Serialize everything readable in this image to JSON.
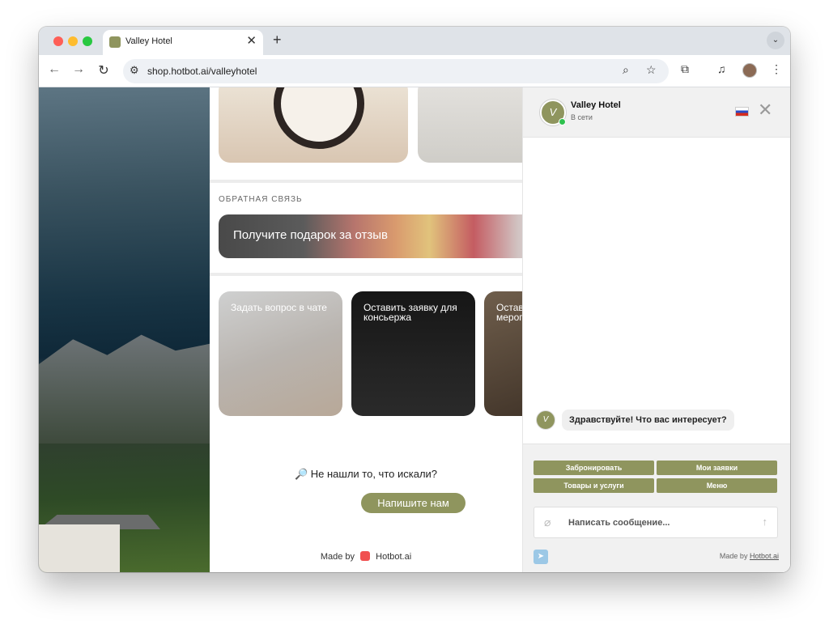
{
  "colors": {
    "accent": "#8f955e",
    "online": "#2ec14e",
    "traffic_red": "#fe5f57",
    "traffic_yellow": "#febc2e",
    "traffic_green": "#28c840"
  },
  "browser": {
    "tab_title": "Valley Hotel",
    "tab_close": "✕",
    "new_tab": "+",
    "tab_menu": "⌄",
    "url": "shop.hotbot.ai/valleyhotel"
  },
  "page": {
    "feedback_section_title": "ОБРАТНАЯ СВЯЗЬ",
    "feedback_banner": "Получите подарок за отзыв",
    "services": [
      {
        "label": "Задать вопрос в чате"
      },
      {
        "label": "Оставить заявку для консьержа"
      },
      {
        "label": "Оставить заявку на мероприятие"
      }
    ],
    "not_found_icon": "🔎",
    "not_found_text": "Не нашли то, что искали?",
    "write_us_button": "Напишите нам",
    "made_by": "Made by",
    "made_by_brand": "Hotbot.ai"
  },
  "chat": {
    "title": "Valley Hotel",
    "status": "В сети",
    "close_icon": "✕",
    "greeting": "Здравствуйте! Что вас интересует?",
    "quick_replies": [
      "Забронировать",
      "Мои заявки",
      "Товары и услуги",
      "Меню"
    ],
    "input_placeholder": "Написать сообщение...",
    "footer_made_by": "Made by",
    "footer_brand": "Hotbot.ai"
  }
}
